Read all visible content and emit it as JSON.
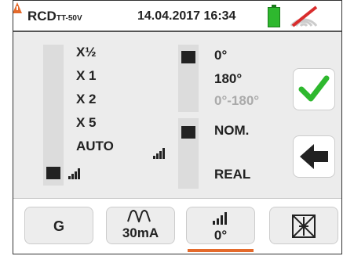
{
  "header": {
    "mode": "RCD",
    "mode_sub": "TT-50V",
    "datetime": "14.04.2017  16:34",
    "battery_icon": "battery-full-icon",
    "wifi_icon": "wifi-disabled-icon"
  },
  "multiplier": {
    "options": [
      "X½",
      "X 1",
      "X 2",
      "X 5",
      "AUTO"
    ],
    "selected_index": 4
  },
  "phase": {
    "options": [
      "0°",
      "180°",
      "0°-180°"
    ],
    "disabled_index": 2,
    "selected": "0°"
  },
  "current_mode": {
    "options": [
      "NOM.",
      "REAL"
    ],
    "selected": "NOM."
  },
  "actions": {
    "confirm_icon": "checkmark-icon",
    "back_icon": "arrow-left-icon"
  },
  "footer": {
    "tab1": "G",
    "tab2": "30mA",
    "tab3": "0°",
    "tab4_icon": "rcd-disabled-icon",
    "active_tab": 3
  },
  "colors": {
    "accent": "#e46a2b",
    "check": "#2eb82e"
  }
}
